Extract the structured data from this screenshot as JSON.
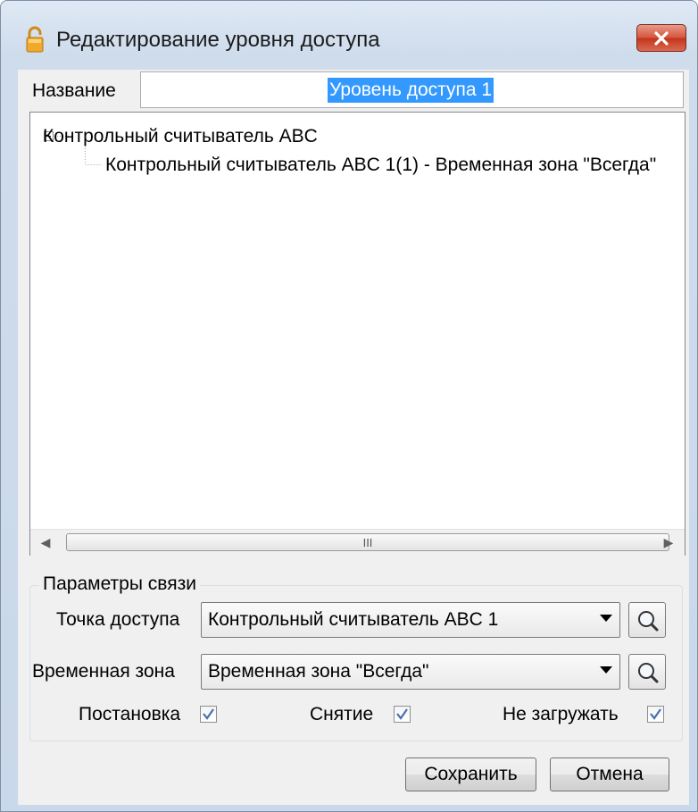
{
  "window": {
    "title": "Редактирование уровня доступа",
    "close_label": "✕"
  },
  "name_field": {
    "label": "Название",
    "value": "Уровень доступа 1"
  },
  "tree": {
    "root": "Контрольный считыватель ABC",
    "child": "Контрольный считыватель ABC 1(1) - Временная зона \"Всегда\""
  },
  "scrollbar": {
    "thumb_grip": "III"
  },
  "link_params": {
    "group_title": "Параметры связи",
    "access_point": {
      "label": "Точка доступа",
      "value": "Контрольный считыватель ABC 1"
    },
    "time_zone": {
      "label": "Временная зона",
      "value": "Временная зона \"Всегда\""
    },
    "checkboxes": [
      {
        "label": "Постановка",
        "checked": true
      },
      {
        "label": "Снятие",
        "checked": true
      },
      {
        "label": "Не загружать",
        "checked": true
      }
    ]
  },
  "buttons": {
    "save": "Сохранить",
    "cancel": "Отмена"
  },
  "icons": {
    "title": "unlock-icon",
    "search": "magnifier-icon",
    "close": "close-icon"
  }
}
